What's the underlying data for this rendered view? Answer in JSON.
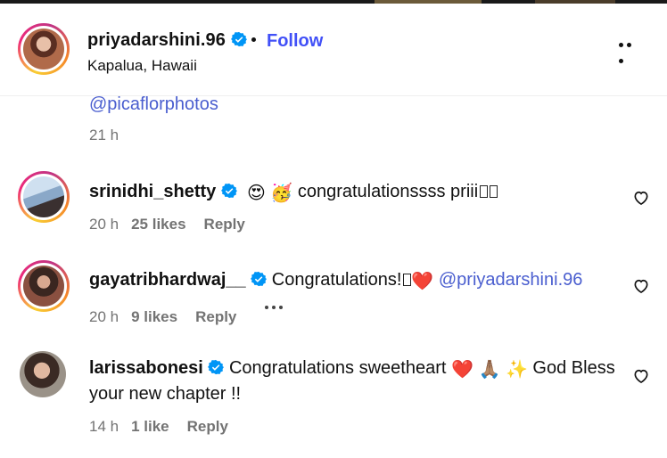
{
  "header": {
    "username": "priyadarshini.96",
    "follow_label": "Follow",
    "location": "Kapalua, Hawaii"
  },
  "previous": {
    "mention": "@picaflorphotos",
    "time": "21 h"
  },
  "comments": [
    {
      "username": "srinidhi_shetty",
      "emoji": [
        "😍",
        "🥳"
      ],
      "text": "congratulationssss priii",
      "time": "20 h",
      "likes": "25 likes",
      "reply": "Reply"
    },
    {
      "username": "gayatribhardwaj__",
      "text": "Congratulations!",
      "emoji": [
        "❤️"
      ],
      "mention": "@priyadarshini.96",
      "time": "20 h",
      "likes": "9 likes",
      "reply": "Reply"
    },
    {
      "username": "larissabonesi",
      "text": "Congratulations sweetheart",
      "emoji": [
        "❤️",
        "🙏🏽",
        "✨"
      ],
      "text2": "God Bless your new chapter !!",
      "time": "14 h",
      "likes": "1 like",
      "reply": "Reply"
    }
  ],
  "colors": {
    "link": "#4150f7",
    "mention": "#4a5ecf",
    "meta": "#737373",
    "verified": "#0095f6"
  }
}
